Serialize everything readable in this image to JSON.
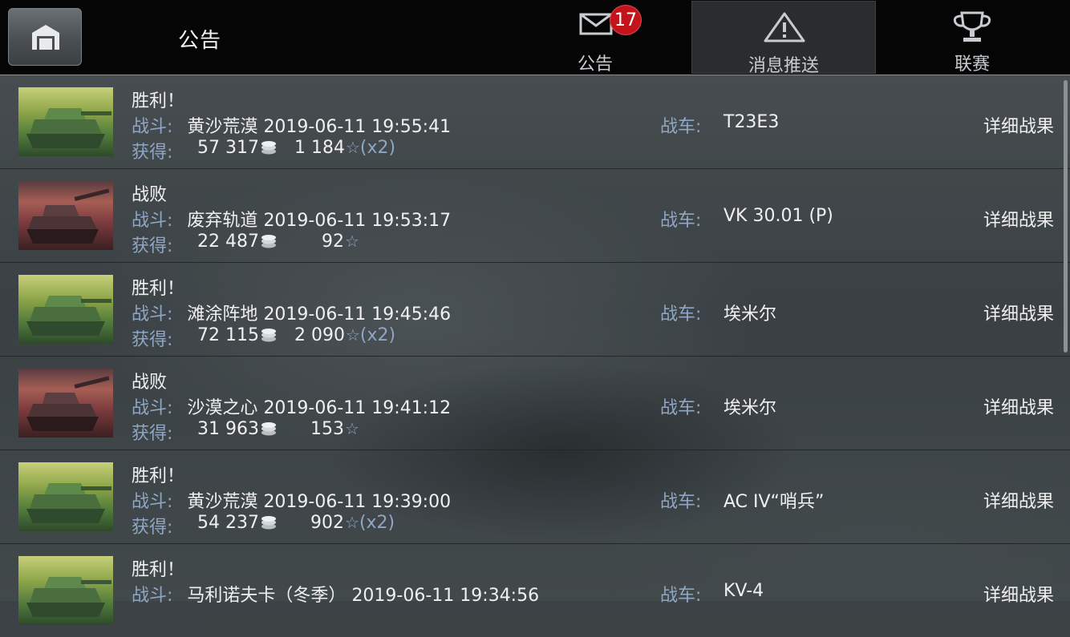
{
  "header": {
    "title": "公告",
    "tabs": [
      {
        "label": "公告",
        "icon": "envelope-icon",
        "badge": "17"
      },
      {
        "label": "消息推送",
        "icon": "warning-icon"
      },
      {
        "label": "联赛",
        "icon": "trophy-icon"
      }
    ]
  },
  "labels": {
    "battle": "战斗:",
    "earned": "获得:",
    "tank": "战车:",
    "detail": "详细战果"
  },
  "battles": [
    {
      "result": "胜利！",
      "outcome": "win",
      "map": "黄沙荒漠",
      "datetime": "2019-06-11 19:55:41",
      "silver": "57 317",
      "xp": "1 184",
      "multiplier": "(x2)",
      "tank": "T23E3"
    },
    {
      "result": "战败",
      "outcome": "loss",
      "map": "废弃轨道",
      "datetime": "2019-06-11 19:53:17",
      "silver": "22 487",
      "xp": "92",
      "multiplier": "",
      "tank": "VK 30.01 (P)"
    },
    {
      "result": "胜利！",
      "outcome": "win",
      "map": "滩涂阵地",
      "datetime": "2019-06-11 19:45:46",
      "silver": "72 115",
      "xp": "2 090",
      "multiplier": "(x2)",
      "tank": "埃米尔"
    },
    {
      "result": "战败",
      "outcome": "loss",
      "map": "沙漠之心",
      "datetime": "2019-06-11 19:41:12",
      "silver": "31 963",
      "xp": "153",
      "multiplier": "",
      "tank": "埃米尔"
    },
    {
      "result": "胜利！",
      "outcome": "win",
      "map": "黄沙荒漠",
      "datetime": "2019-06-11 19:39:00",
      "silver": "54 237",
      "xp": "902",
      "multiplier": "(x2)",
      "tank": "AC IV“哨兵”"
    },
    {
      "result": "胜利！",
      "outcome": "win",
      "map": "马利诺夫卡（冬季）",
      "datetime": "2019-06-11 19:34:56",
      "silver": "",
      "xp": "",
      "multiplier": "",
      "tank": "KV-4"
    }
  ],
  "colors": {
    "label_blue": "#8fa6c4",
    "badge_red": "#c2141a",
    "header_border": "#b8893a"
  }
}
